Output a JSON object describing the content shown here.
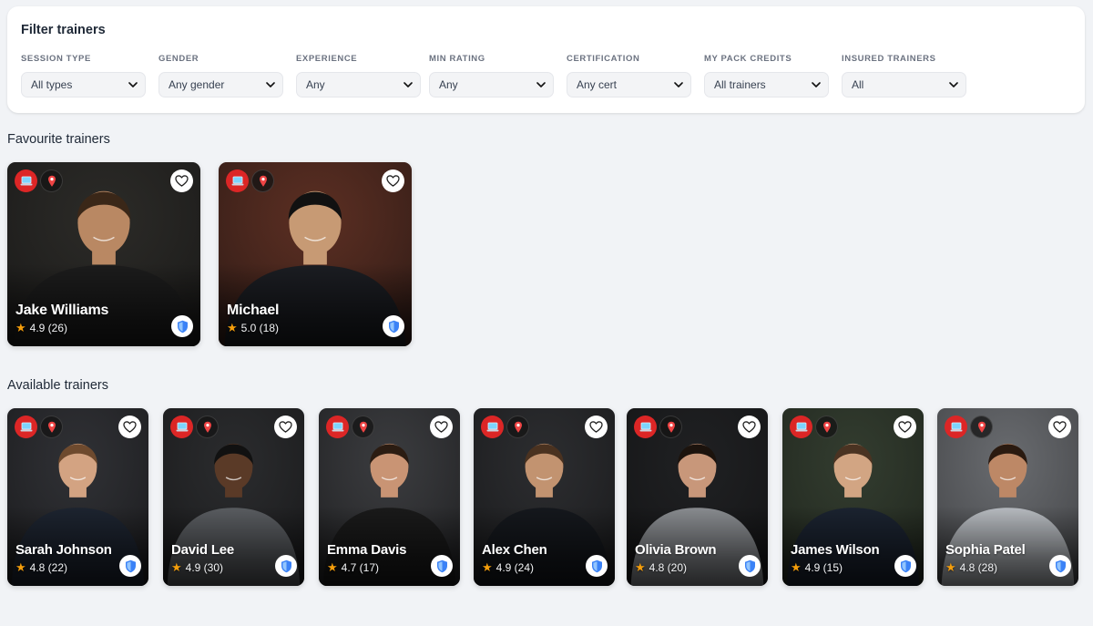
{
  "filters": {
    "title": "Filter trainers",
    "items": [
      {
        "label": "SESSION TYPE",
        "value": "All types"
      },
      {
        "label": "GENDER",
        "value": "Any gender"
      },
      {
        "label": "EXPERIENCE",
        "value": "Any"
      },
      {
        "label": "MIN RATING",
        "value": "Any"
      },
      {
        "label": "CERTIFICATION",
        "value": "Any cert"
      },
      {
        "label": "MY PACK CREDITS",
        "value": "All trainers"
      },
      {
        "label": "INSURED TRAINERS",
        "value": "All"
      }
    ]
  },
  "favourites": {
    "title": "Favourite trainers",
    "trainers": [
      {
        "name": "Jake Williams",
        "rating": "4.9 (26)",
        "bg": "#2b2a27",
        "skin": "#b98863",
        "hair": "#3a2718",
        "shirt": "#1c1c1c"
      },
      {
        "name": "Michael",
        "rating": "5.0 (18)",
        "bg": "#5a2e22",
        "skin": "#c79a74",
        "hair": "#111111",
        "shirt": "#1b1d22"
      }
    ]
  },
  "available": {
    "title": "Available trainers",
    "trainers": [
      {
        "name": "Sarah Johnson",
        "rating": "4.8 (22)",
        "bg": "#2f3034",
        "skin": "#d3a382",
        "hair": "#6e4a2e",
        "shirt": "#1d2430"
      },
      {
        "name": "David Lee",
        "rating": "4.9 (30)",
        "bg": "#2a2b2d",
        "skin": "#5a3a27",
        "hair": "#111111",
        "shirt": "#5a5d61"
      },
      {
        "name": "Emma Davis",
        "rating": "4.7 (17)",
        "bg": "#3a3b3e",
        "skin": "#c99474",
        "hair": "#2b1c12",
        "shirt": "#1a1a1a"
      },
      {
        "name": "Alex Chen",
        "rating": "4.9 (24)",
        "bg": "#2c2d30",
        "skin": "#c29370",
        "hair": "#4a3220",
        "shirt": "#15181d"
      },
      {
        "name": "Olivia Brown",
        "rating": "4.8 (20)",
        "bg": "#1f2022",
        "skin": "#c8977a",
        "hair": "#1c130d",
        "shirt": "#8a8d91"
      },
      {
        "name": "James Wilson",
        "rating": "4.9 (15)",
        "bg": "#3c4a35",
        "skin": "#d2a583",
        "hair": "#4a3322",
        "shirt": "#1b2330"
      },
      {
        "name": "Sophia Patel",
        "rating": "4.8 (28)",
        "bg": "#8d9095",
        "skin": "#bd8866",
        "hair": "#2a1a10",
        "shirt": "#b8bcc1"
      }
    ]
  },
  "colors": {
    "online_badge": "#dc2626",
    "star": "#f59e0b",
    "shield": "#3b82f6"
  },
  "icons": {
    "online": "laptop-icon",
    "in_person": "location-pin-icon",
    "favourite": "heart-icon",
    "insured": "shield-icon",
    "dropdown": "chevron-down-icon",
    "rating": "star-icon"
  }
}
